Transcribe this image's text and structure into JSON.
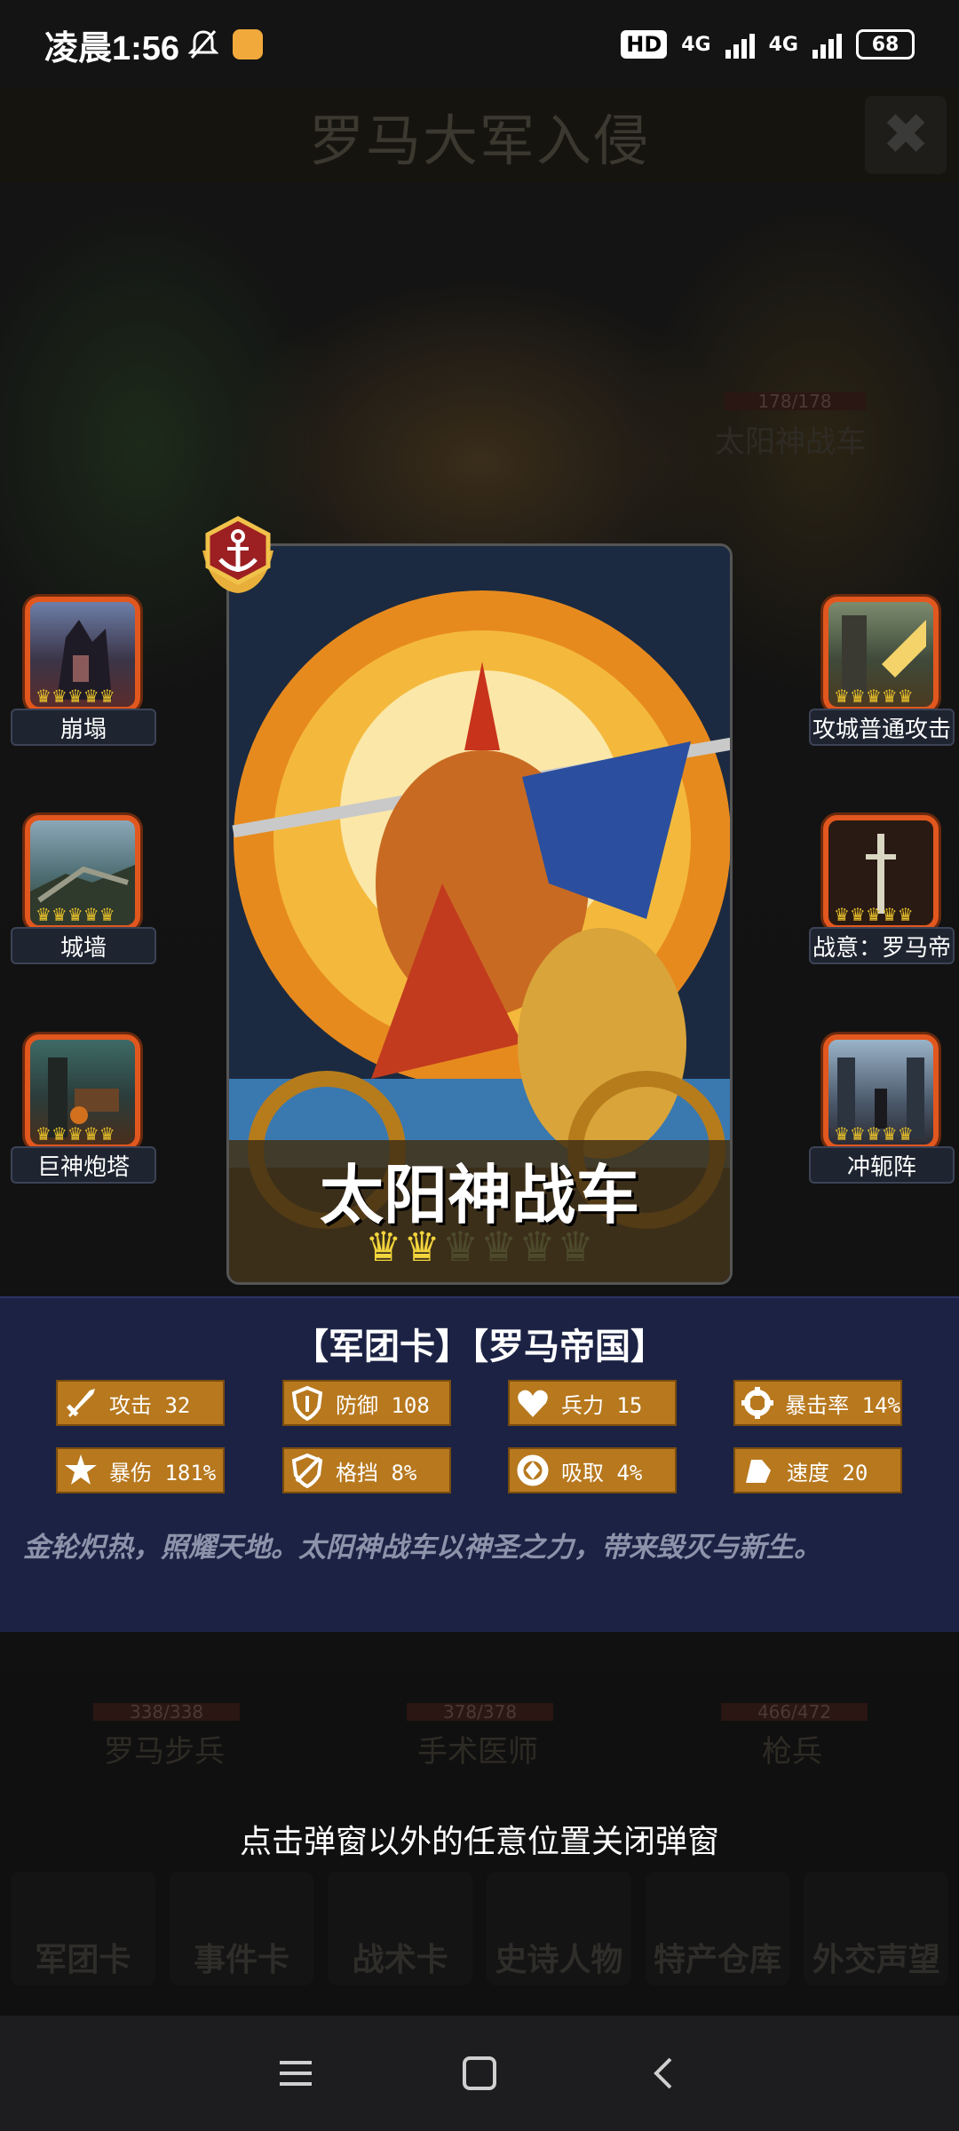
{
  "status_bar": {
    "time": "凌晨1:56",
    "hd": "HD",
    "net1": "4G",
    "net2": "4G",
    "battery": "68"
  },
  "background": {
    "title": "罗马大军入侵",
    "close_glyph": "✖",
    "hero_name": "太阳神战车",
    "hero_hp": "178/178",
    "units": [
      {
        "name": "罗马步兵",
        "hp": "338/338"
      },
      {
        "name": "手术医师",
        "hp": "378/378"
      },
      {
        "name": "枪兵",
        "hp": "466/472"
      }
    ]
  },
  "left_skills": [
    {
      "label": "崩塌",
      "icon": "collapse-icon"
    },
    {
      "label": "城墙",
      "icon": "city-wall-icon"
    },
    {
      "label": "巨神炮塔",
      "icon": "giant-cannon-tower-icon"
    }
  ],
  "right_skills": [
    {
      "label": "攻城普通攻击",
      "icon": "siege-attack-icon"
    },
    {
      "label": "战意：罗马帝",
      "icon": "war-spirit-icon"
    },
    {
      "label": "冲轭阵",
      "icon": "yoke-formation-icon"
    }
  ],
  "card": {
    "name": "太阳神战车",
    "crowns_filled": 2,
    "crowns_total": 6,
    "badge_icon": "anchor-icon"
  },
  "info": {
    "tags": "【军团卡】【罗马帝国】",
    "stats": [
      {
        "label": "攻击",
        "value": "32",
        "icon": "sword-icon"
      },
      {
        "label": "防御",
        "value": "108",
        "icon": "shield-icon"
      },
      {
        "label": "兵力",
        "value": "15",
        "icon": "heart-icon"
      },
      {
        "label": "暴击率",
        "value": "14%",
        "icon": "crit-rate-icon"
      },
      {
        "label": "暴伤",
        "value": "181%",
        "icon": "crit-damage-icon"
      },
      {
        "label": "格挡",
        "value": "8%",
        "icon": "block-icon"
      },
      {
        "label": "吸取",
        "value": "4%",
        "icon": "lifesteal-icon"
      },
      {
        "label": "速度",
        "value": "20",
        "icon": "speed-icon"
      }
    ],
    "flavor": "金轮炽热，照耀天地。太阳神战车以神圣之力，带来毁灭与新生。"
  },
  "close_hint": "点击弹窗以外的任意位置关闭弹窗",
  "bottom_tabs": [
    "军团卡",
    "事件卡",
    "战术卡",
    "史诗人物",
    "特产仓库",
    "外交声望"
  ],
  "colors": {
    "accent_orange": "#e2571e",
    "stat_gold": "#b7781e",
    "panel_navy": "#1b2244"
  }
}
